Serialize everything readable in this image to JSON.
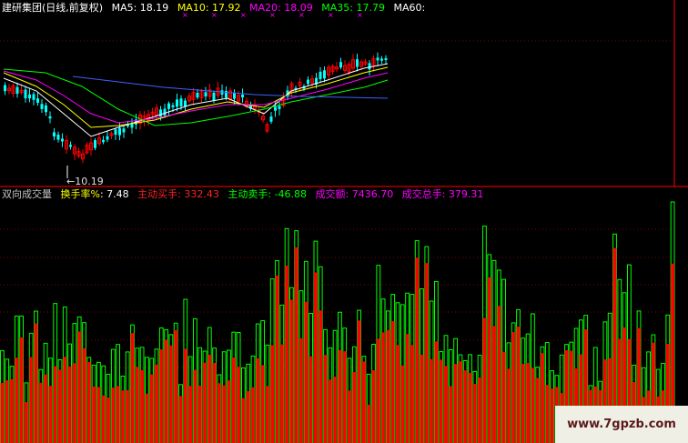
{
  "header_top": {
    "title": "建研集团(日线,前复权)",
    "ma5": "MA5: 18.19",
    "ma10": "MA10: 17.92",
    "ma20": "MA20: 18.09",
    "ma35": "MA35: 17.79",
    "ma60": "MA60:"
  },
  "header_bottom": {
    "title": "双向成交量",
    "turnover_label": "换手率%",
    "turnover_value": ": 7.48",
    "active_buy": "主动买手: 332.43",
    "active_sell": "主动卖手: -46.88",
    "amount": "成交额: 7436.70",
    "total_hands": "成交总手: 379.31"
  },
  "low_marker": "←10.19",
  "watermark": "www.7gpzb.com",
  "colors": {
    "background": "#000000",
    "up": "#ff0000",
    "down": "#00ffff",
    "white": "#ffffff",
    "yellow": "#ffff00",
    "magenta": "#ff00ff",
    "green": "#00ff00",
    "grid": "#800000",
    "divider": "#ff0000"
  }
}
